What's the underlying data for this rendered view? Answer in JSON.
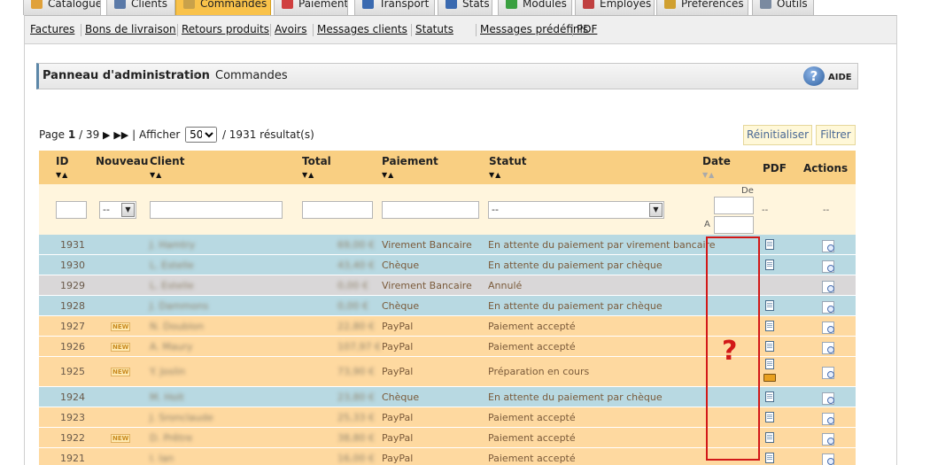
{
  "tabs": [
    {
      "label": "Catalogue",
      "color": "#e0a13a"
    },
    {
      "label": "Clients",
      "color": "#5b7aa8"
    },
    {
      "label": "Commandes",
      "color": "#c9a14a",
      "active": true
    },
    {
      "label": "Paiement",
      "color": "#d04040"
    },
    {
      "label": "Transport",
      "color": "#3a6ab0"
    },
    {
      "label": "Stats",
      "color": "#3a6ab0"
    },
    {
      "label": "Modules",
      "color": "#3aa040"
    },
    {
      "label": "Employés",
      "color": "#c04040"
    },
    {
      "label": "Préférences",
      "color": "#d0a030"
    },
    {
      "label": "Outils",
      "color": "#7a8aa0"
    }
  ],
  "submenu": [
    "Factures",
    "Bons de livraison",
    "Retours produits",
    "Avoirs",
    "Messages clients",
    "Statuts",
    "Messages prédéfinis",
    "PDF"
  ],
  "breadcrumb": {
    "root": "Panneau d'administration",
    "separator": "›",
    "current": "Commandes",
    "help_label": "AIDE",
    "help_glyph": "?"
  },
  "pager": {
    "page_prefix": "Page",
    "page": "1",
    "pages": "/ 39",
    "display_label": "| Afficher",
    "per_page": "50",
    "results": "/ 1931 résultat(s)",
    "next_icon": "▶",
    "last_icon": "▶▶"
  },
  "buttons": {
    "reset": "Réinitialiser",
    "filter": "Filtrer"
  },
  "columns": {
    "id": "ID",
    "new": "Nouveau",
    "client": "Client",
    "total": "Total",
    "payment": "Paiement",
    "status": "Statut",
    "date": "Date",
    "pdf": "PDF",
    "actions": "Actions"
  },
  "sort_glyphs": "▼▲",
  "filters": {
    "new_select": "--",
    "status_select": "--",
    "date_from_label": "De",
    "date_to_label": "A",
    "pdf_placeholder": "--",
    "actions_placeholder": "--",
    "select_arrow": "▼"
  },
  "orders": [
    {
      "id": "1931",
      "new": false,
      "client": "J. Hamtry",
      "total": "69,00 €",
      "payment": "Virement Bancaire",
      "status": "En attente du paiement par virement bancaire",
      "color": "blue",
      "pdf": true,
      "truck": false
    },
    {
      "id": "1930",
      "new": false,
      "client": "L. Estelle",
      "total": "43,40 €",
      "payment": "Chèque",
      "status": "En attente du paiement par chèque",
      "color": "blue",
      "pdf": true,
      "truck": false
    },
    {
      "id": "1929",
      "new": false,
      "client": "L. Estelle",
      "total": "0,00 €",
      "payment": "Virement Bancaire",
      "status": "Annulé",
      "color": "gray",
      "pdf": false,
      "truck": false
    },
    {
      "id": "1928",
      "new": false,
      "client": "J. Dammons",
      "total": "0,00 €",
      "payment": "Chèque",
      "status": "En attente du paiement par chèque",
      "color": "blue",
      "pdf": true,
      "truck": false
    },
    {
      "id": "1927",
      "new": true,
      "client": "N. Doublon",
      "total": "22,80 €",
      "payment": "PayPal",
      "status": "Paiement accepté",
      "color": "orange",
      "pdf": true,
      "truck": false
    },
    {
      "id": "1926",
      "new": true,
      "client": "A. Maury",
      "total": "107,97 €",
      "payment": "PayPal",
      "status": "Paiement accepté",
      "color": "orange",
      "pdf": true,
      "truck": false
    },
    {
      "id": "1925",
      "new": true,
      "client": "Y. Joslin",
      "total": "73,90 €",
      "payment": "PayPal",
      "status": "Préparation en cours",
      "color": "orange",
      "pdf": true,
      "truck": true
    },
    {
      "id": "1924",
      "new": false,
      "client": "M. Holt",
      "total": "23,80 €",
      "payment": "Chèque",
      "status": "En attente du paiement par chèque",
      "color": "blue",
      "pdf": true,
      "truck": false
    },
    {
      "id": "1923",
      "new": false,
      "client": "J. Sronclaude",
      "total": "25,33 €",
      "payment": "PayPal",
      "status": "Paiement accepté",
      "color": "orange",
      "pdf": true,
      "truck": false
    },
    {
      "id": "1922",
      "new": true,
      "client": "D. Prêtre",
      "total": "38,80 €",
      "payment": "PayPal",
      "status": "Paiement accepté",
      "color": "orange",
      "pdf": true,
      "truck": false
    },
    {
      "id": "1921",
      "new": false,
      "client": "I. Ian",
      "total": "16,00 €",
      "payment": "PayPal",
      "status": "Paiement accepté",
      "color": "orange",
      "pdf": true,
      "truck": false
    }
  ],
  "badge_text": "NEW",
  "annotation": {
    "mark": "?",
    "color": "#d21818"
  }
}
